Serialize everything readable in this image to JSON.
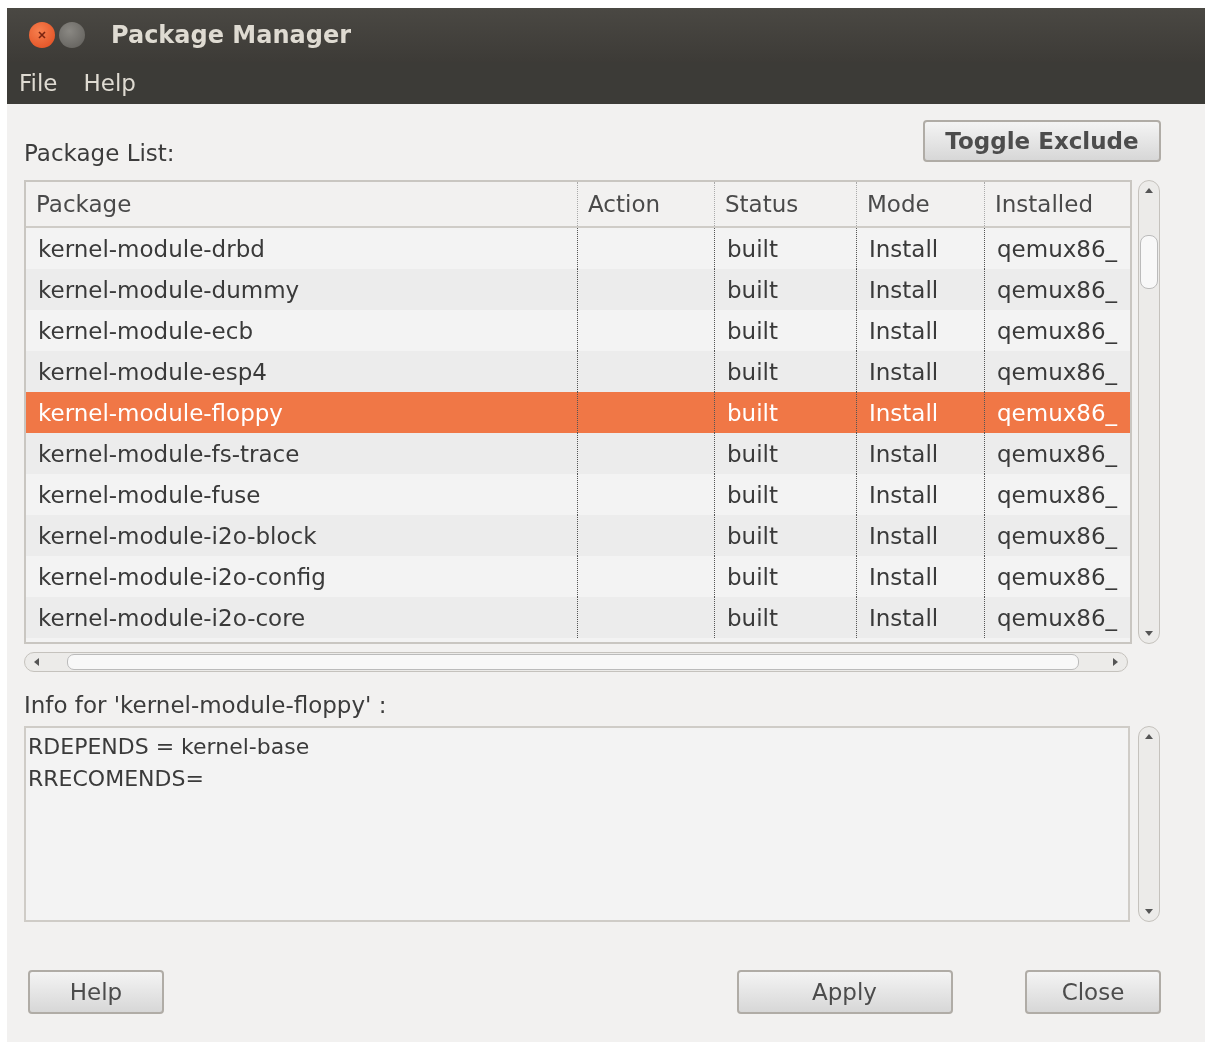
{
  "window": {
    "title": "Package Manager"
  },
  "menu": [
    "File",
    "Help"
  ],
  "toggle_button": "Toggle Exclude",
  "package_list_label": "Package List:",
  "table": {
    "columns": [
      "Package",
      "Action",
      "Status",
      "Mode",
      "Installed"
    ],
    "rows": [
      {
        "cells": [
          "kernel-module-drbd",
          "",
          "built",
          "Install",
          "qemux86_"
        ],
        "selected": false
      },
      {
        "cells": [
          "kernel-module-dummy",
          "",
          "built",
          "Install",
          "qemux86_"
        ],
        "selected": false
      },
      {
        "cells": [
          "kernel-module-ecb",
          "",
          "built",
          "Install",
          "qemux86_"
        ],
        "selected": false
      },
      {
        "cells": [
          "kernel-module-esp4",
          "",
          "built",
          "Install",
          "qemux86_"
        ],
        "selected": false
      },
      {
        "cells": [
          "kernel-module-floppy",
          "",
          "built",
          "Install",
          "qemux86_"
        ],
        "selected": true
      },
      {
        "cells": [
          "kernel-module-fs-trace",
          "",
          "built",
          "Install",
          "qemux86_"
        ],
        "selected": false
      },
      {
        "cells": [
          "kernel-module-fuse",
          "",
          "built",
          "Install",
          "qemux86_"
        ],
        "selected": false
      },
      {
        "cells": [
          "kernel-module-i2o-block",
          "",
          "built",
          "Install",
          "qemux86_"
        ],
        "selected": false
      },
      {
        "cells": [
          "kernel-module-i2o-config",
          "",
          "built",
          "Install",
          "qemux86_"
        ],
        "selected": false
      },
      {
        "cells": [
          "kernel-module-i2o-core",
          "",
          "built",
          "Install",
          "qemux86_"
        ],
        "selected": false
      }
    ]
  },
  "info_label": "Info for 'kernel-module-floppy' :",
  "info_lines": [
    "RDEPENDS = kernel-base",
    "RRECOMENDS="
  ],
  "buttons": [
    "Help",
    "Apply",
    "Close"
  ]
}
